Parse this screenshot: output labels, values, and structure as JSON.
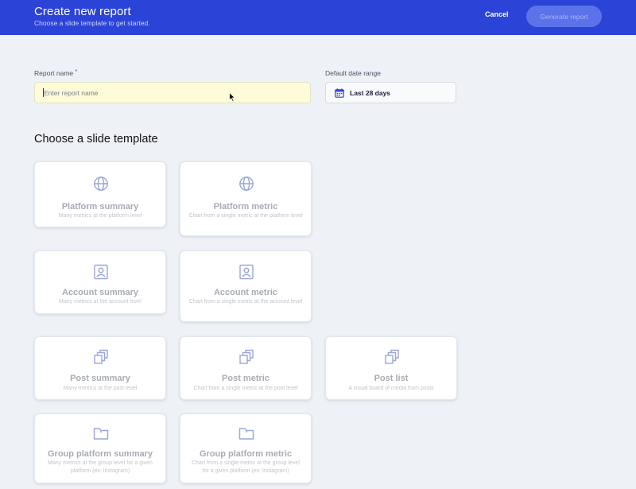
{
  "header": {
    "title": "Create new report",
    "subtitle": "Choose a slide template to get started.",
    "cancel_label": "Cancel",
    "generate_label": "Generate report"
  },
  "form": {
    "report_name_label": "Report name",
    "required_mark": "*",
    "report_name_placeholder": "Enter report name",
    "report_name_value": "",
    "date_range_label": "Default date range",
    "date_range_value": "Last 28 days"
  },
  "templates_section": {
    "title": "Choose a slide template",
    "cards": [
      {
        "title": "Platform summary",
        "description": "Many metrics at the platform level",
        "icon": "globe-icon"
      },
      {
        "title": "Platform metric",
        "description": "Chart from a single metric at the platform level",
        "icon": "globe-icon"
      },
      {
        "title": "Account summary",
        "description": "Many metrics at the account level",
        "icon": "account-icon"
      },
      {
        "title": "Account metric",
        "description": "Chart from a single metric at the account level",
        "icon": "account-icon"
      },
      {
        "title": "Post summary",
        "description": "Many metrics at the post level",
        "icon": "stack-icon"
      },
      {
        "title": "Post metric",
        "description": "Chart from a single metric at the post level",
        "icon": "stack-icon"
      },
      {
        "title": "Post list",
        "description": "A visual board of media from posts",
        "icon": "stack-icon"
      },
      {
        "title": "Group platform summary",
        "description": "Many metrics at the group level for a given platform (ex: Instagram)",
        "icon": "folder-icon"
      },
      {
        "title": "Group platform metric",
        "description": "Chart from a single metric at the group level for a given platform (ex: Instagram)",
        "icon": "folder-icon"
      }
    ]
  },
  "colors": {
    "header_bg": "#2b43d6",
    "primary_disabled": "#5b72ea",
    "icon_tint": "#9aa6d8",
    "input_highlight": "#fdfbd8"
  }
}
